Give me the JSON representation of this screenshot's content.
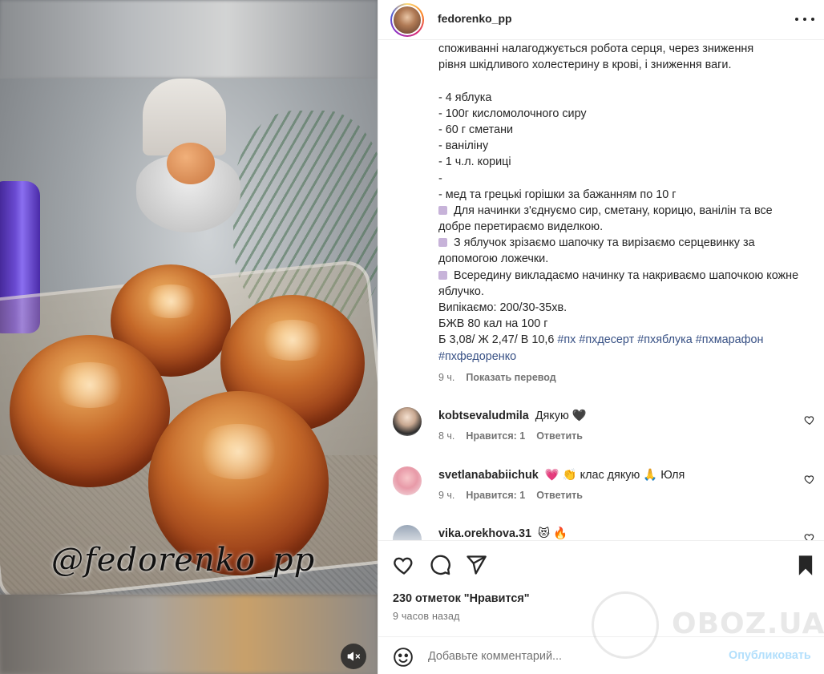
{
  "media": {
    "watermark": "@fedorenko_pp",
    "mute_icon": "speaker-muted-icon"
  },
  "post": {
    "username": "fedorenko_pp",
    "more_icon": "more-options-icon"
  },
  "caption": {
    "intro_line1": "споживанні налагоджується робота серця, через зниження",
    "intro_line2": "рівня шкідливого холестерину в крові, і зниження ваги.",
    "ingredients": [
      "- 4 яблука",
      "- 100г кисломолочного сиру",
      "- 60 г сметани",
      "- ваніліну",
      "- 1 ч.л. кориці",
      "-",
      "- мед та грецькі горішки за бажанням по 10 г"
    ],
    "steps": [
      "Для начинки з'єднуємо сир, сметану, корицю, ванілін та все добре перетираємо виделкою.",
      "З яблучок зрізаємо шапочку та вирізаємо серцевинку за допомогою ложечки.",
      "Всередину викладаємо начинку та накриваємо шапочкою кожне яблучко."
    ],
    "bake": "Випікаємо: 200/30-35хв.",
    "kbzhu": "БЖВ 80 кал на 100 г",
    "macros": "Б 3,08/ Ж 2,47/ В 10,6",
    "hashtags_line1": "#пх #пхдесерт #пхяблука #пхмарафон",
    "hashtags_line2": "#пхфедоренко",
    "time": "9 ч.",
    "translate": "Показать перевод"
  },
  "comments": [
    {
      "user": "kobtsevaludmila",
      "text": "Дякую 🖤",
      "time": "8 ч.",
      "likes": "Нравится: 1",
      "reply": "Ответить"
    },
    {
      "user": "svetlanababiichuk",
      "text": "💗 👏 клас дякую 🙏 Юля",
      "time": "9 ч.",
      "likes": "Нравится: 1",
      "reply": "Ответить"
    },
    {
      "user": "vika.orekhova.31",
      "text": "😻 🔥"
    }
  ],
  "actions": {
    "like_icon": "heart-icon",
    "comment_icon": "comment-icon",
    "share_icon": "share-icon",
    "save_icon": "bookmark-icon",
    "likes_text": "230 отметок \"Нравится\"",
    "posted": "9 часов назад"
  },
  "comment_bar": {
    "emoji_icon": "emoji-icon",
    "placeholder": "Добавьте комментарий...",
    "publish": "Опубликовать"
  },
  "overlay": {
    "brand": "OBOZ.UA"
  },
  "colors": {
    "link": "#385185",
    "muted": "#737373",
    "publish_disabled": "#b2dffc",
    "text": "#262626"
  }
}
